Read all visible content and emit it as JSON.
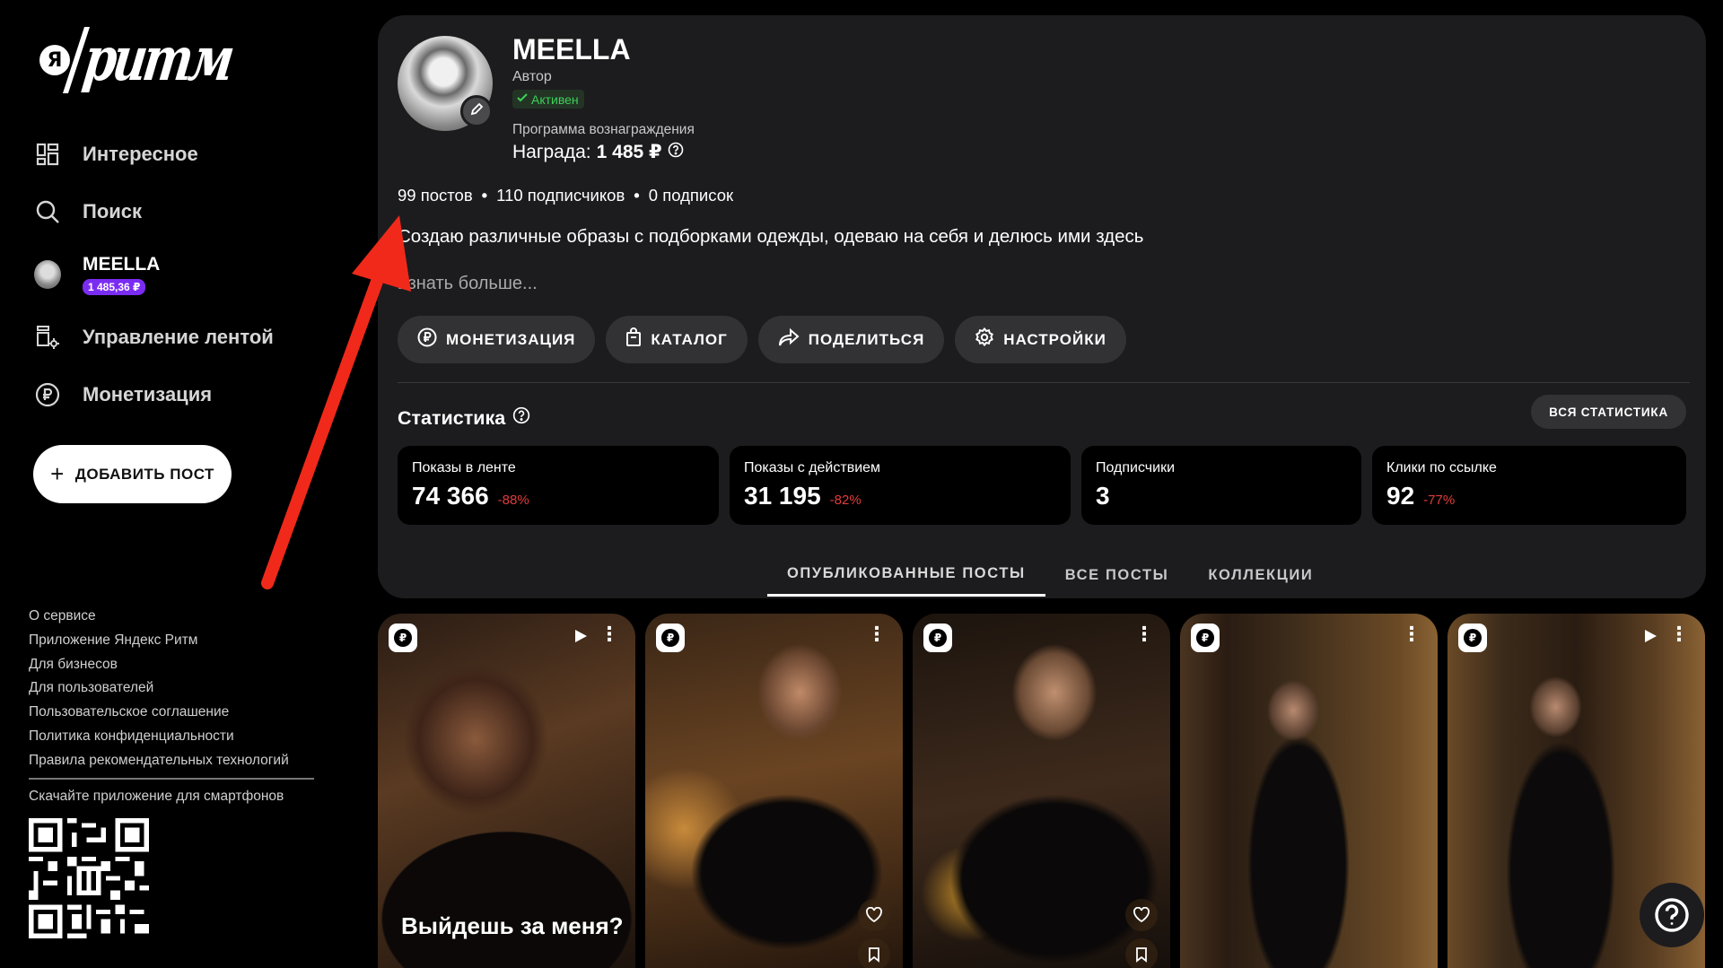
{
  "sidebar": {
    "logo_mark": "Я",
    "logo_text": "ритм",
    "nav": [
      {
        "label": "Интересное",
        "icon": "grid-icon"
      },
      {
        "label": "Поиск",
        "icon": "search-icon"
      }
    ],
    "user": {
      "name": "MEELLA",
      "balance": "1 485,36 ₽"
    },
    "nav2": [
      {
        "label": "Управление лентой",
        "icon": "feed-settings-icon"
      },
      {
        "label": "Монетизация",
        "icon": "ruble-icon"
      }
    ],
    "add_post": "ДОБАВИТЬ ПОСТ",
    "footer_links": [
      "О сервисе",
      "Приложение Яндекс Ритм",
      "Для бизнесов",
      "Для пользователей",
      "Пользовательское соглашение",
      "Политика конфиденциальности",
      "Правила рекомендательных технологий"
    ],
    "download_text": "Скачайте приложение для смартфонов"
  },
  "profile": {
    "name": "MEELLA",
    "role": "Автор",
    "status": "Активен",
    "reward_program": "Программа вознаграждения",
    "reward_label": "Награда:",
    "reward_value": "1 485 ₽",
    "posts": "99 постов",
    "subscribers": "110 подписчиков",
    "subscriptions": "0 подписок",
    "description": "Создаю различные образы с подборками одежды, одеваю на себя и делюсь ими здесь",
    "learn_more": "Узнать больше...",
    "actions": [
      {
        "label": "МОНЕТИЗАЦИЯ",
        "icon": "ruble-icon"
      },
      {
        "label": "КАТАЛОГ",
        "icon": "bag-icon"
      },
      {
        "label": "ПОДЕЛИТЬСЯ",
        "icon": "share-icon"
      },
      {
        "label": "НАСТРОЙКИ",
        "icon": "gear-icon"
      }
    ]
  },
  "stats": {
    "title": "Статистика",
    "all_stats": "ВСЯ СТАТИСТИКА",
    "cards": [
      {
        "label": "Показы в ленте",
        "value": "74 366",
        "change": "-88%"
      },
      {
        "label": "Показы с действием",
        "value": "31 195",
        "change": "-82%"
      },
      {
        "label": "Подписчики",
        "value": "3",
        "change": ""
      },
      {
        "label": "Клики по ссылке",
        "value": "92",
        "change": "-77%"
      }
    ]
  },
  "tabs": [
    "ОПУБЛИКОВАННЫЕ ПОСТЫ",
    "ВСЕ ПОСТЫ",
    "КОЛЛЕКЦИИ"
  ],
  "active_tab": "ОПУБЛИКОВАННЫЕ ПОСТЫ",
  "posts": [
    {
      "caption": "Выйдешь за меня?",
      "video": true,
      "actions": false
    },
    {
      "caption": "",
      "video": false,
      "actions": true
    },
    {
      "caption": "",
      "video": false,
      "actions": true
    },
    {
      "caption": "",
      "video": false,
      "actions": false
    },
    {
      "caption": "",
      "video": true,
      "actions": false
    }
  ],
  "colors": {
    "accent_purple": "#7b2cf2",
    "active_green": "#3fcf5a",
    "negative_red": "#e23b3b",
    "panel_bg": "#1c1c1e",
    "annotation_arrow": "#f0291b"
  }
}
